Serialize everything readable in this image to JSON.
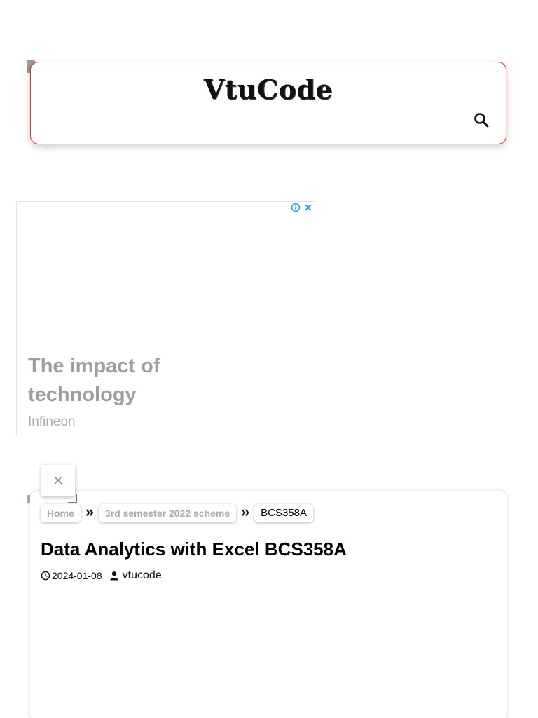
{
  "header": {
    "logo_text": "VtuCode",
    "search_icon": "search-icon"
  },
  "ad": {
    "info_icon": "info-icon",
    "close_icon": "close-icon",
    "headline": "The impact of technology",
    "advertiser": "Infineon"
  },
  "floating_close": {
    "label": "✕"
  },
  "breadcrumb": {
    "items": [
      {
        "label": "Home"
      },
      {
        "label": "3rd semester 2022 scheme"
      },
      {
        "label": "BCS358A"
      }
    ],
    "separator": "»"
  },
  "post": {
    "title": "Data Analytics with Excel BCS358A",
    "date": "2024-01-08",
    "author": "vtucode"
  },
  "colors": {
    "header_border": "#e8312a",
    "ad_text": "#9e9e9e",
    "ad_info": "#1a9bd7"
  }
}
